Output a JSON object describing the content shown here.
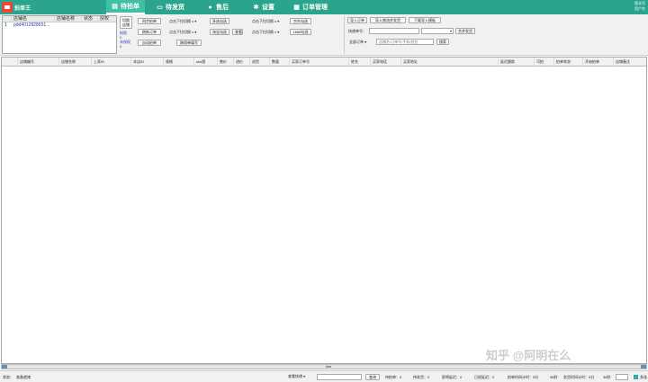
{
  "app": {
    "name": "拍单王",
    "version_line1": "版本号",
    "version_line2": "用户名"
  },
  "nav": [
    {
      "label": "待拍单",
      "icon": "document-icon",
      "glyph": "▤"
    },
    {
      "label": "待发货",
      "icon": "truck-icon",
      "glyph": "▭"
    },
    {
      "label": "售后",
      "icon": "chat-icon",
      "glyph": "●"
    },
    {
      "label": "设置",
      "icon": "gear-icon",
      "glyph": "✱"
    },
    {
      "label": "订单管理",
      "icon": "grid-icon",
      "glyph": "▦"
    }
  ],
  "stores": {
    "headers": [
      "店铺名",
      "店铺名称",
      "状态",
      "授权"
    ],
    "rows": [
      {
        "num": "1",
        "name": "pdd4012828651..."
      }
    ]
  },
  "side_labels": {
    "switch_store": "切换店铺",
    "auth": "授权",
    "auth_count": "0",
    "unauth": "未授权",
    "unauth_count": "0"
  },
  "toolbar": {
    "sync_orders": "同步拍单",
    "refresh_orders": "刷新订单",
    "auto_order": "自动拍单",
    "dropdown1": "点击下拉切换",
    "dropdown2": "点击下拉切换",
    "multi_select": "多选勾选",
    "taobao_select": "淘宝勾选",
    "query": "查看",
    "multi_order_fill": "跨境单填写",
    "dropdown3": "点击下拉切换",
    "dropdown4": "点击下拉切换",
    "yunda_select": "京东勾选",
    "select_1688": "1688勾选",
    "import_orders": "导入订单",
    "import_logistics": "导入物流并发货",
    "download_template": "下载导入模板",
    "tracking_label": "快递单号：",
    "merge_ship": "合并发货",
    "all_orders": "全部订单",
    "search_placeholder": "店铺名/订单号/手机/姓名",
    "search": "搜索"
  },
  "grid_headers": [
    "店铺编号",
    "店铺名称",
    "上家ID",
    "本店ID",
    "规格",
    "sku图",
    "售价",
    "进价",
    "进货",
    "数量",
    "买家订单号",
    "姓名",
    "买家电话",
    "买家地址",
    "延迟跟踪",
    "可拍",
    "拍单状态",
    "开始拍单",
    "店铺备注"
  ],
  "status": {
    "state_label": "状态：",
    "state_value": "准备就绪",
    "filter_select": "查看快递",
    "query_btn": "查询",
    "pending_order": "待拍单：0",
    "pending_ship": "待发货：0",
    "days_delay": "即将延迟：0",
    "delayed": "已经延迟：0",
    "order_timer": "拍单时间计时：5分",
    "order_timer2": "38秒",
    "ship_timer": "发货时间计时：9分",
    "ship_timer2": "38秒",
    "multi_select": "多选"
  },
  "watermark": "知乎 @阿明在么"
}
